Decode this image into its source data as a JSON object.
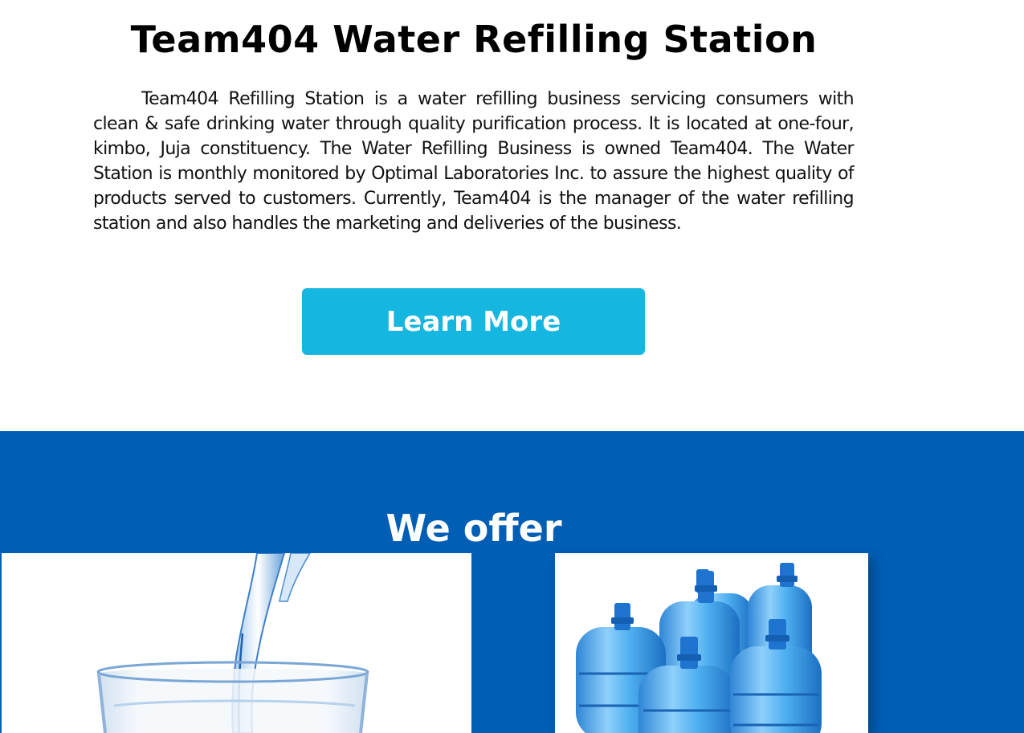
{
  "hero": {
    "title": "Team404 Water Refilling Station",
    "description": "Team404 Refilling Station is a water refilling business servicing consumers with clean & safe drinking water through quality purification process. It is located at one-four, kimbo, Juja constituency. The Water Refilling Business is owned Team404. The Water Station is monthly monitored by Optimal Laboratories Inc. to assure the highest quality of products served to customers. Currently, Team404 is the manager of the water refilling station and also handles the marketing and deliveries of the business.",
    "cta_label": "Learn More"
  },
  "offer": {
    "title": "We offer",
    "cards": [
      {
        "image": "water-pouring-glass-image"
      },
      {
        "image": "water-gallon-bottles-image"
      }
    ]
  },
  "colors": {
    "button": "#15b6e0",
    "band": "#005eb5"
  }
}
